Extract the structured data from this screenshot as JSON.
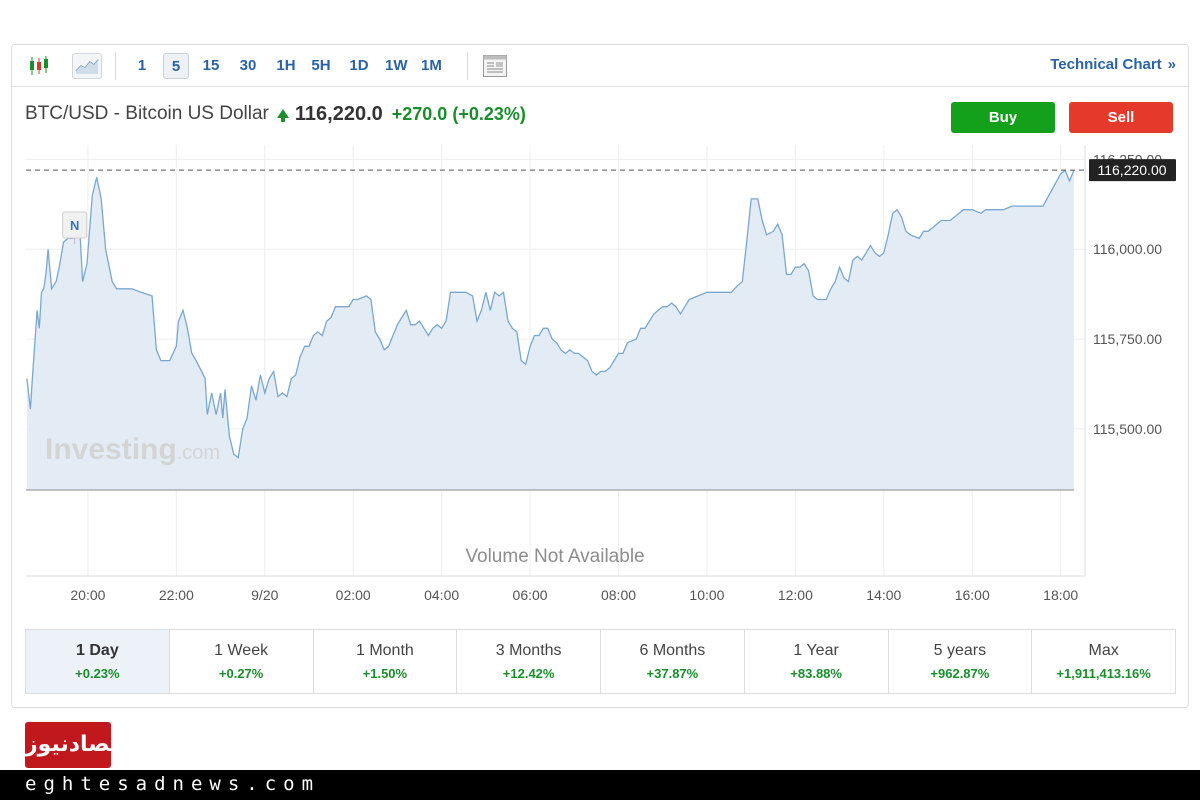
{
  "toolbar": {
    "candles_icon": "candlestick-chart-icon",
    "line_icon": "line-chart-icon",
    "intervals": [
      "1",
      "5",
      "15",
      "30",
      "1H",
      "5H",
      "1D",
      "1W",
      "1M"
    ],
    "active_interval": "5",
    "layout_icon": "chart-layout-icon",
    "technical_link": "Technical Chart",
    "technical_chevron": "»"
  },
  "header": {
    "pair": "BTC/USD - Bitcoin US Dollar",
    "price": "116,220.0",
    "change": "+270.0",
    "change_pct": "(+0.23%)",
    "buy_label": "Buy",
    "sell_label": "Sell"
  },
  "chart_data": {
    "type": "area",
    "y_ticks": [
      "116,250.00",
      "116,000.00",
      "115,750.00",
      "115,500.00"
    ],
    "y_tick_values": [
      116250,
      116000,
      115750,
      115500
    ],
    "ylim": [
      115330,
      116290
    ],
    "current_value_label": "116,220.00",
    "current_value": 116220,
    "x_ticks": [
      "20:00",
      "22:00",
      "9/20",
      "02:00",
      "04:00",
      "06:00",
      "08:00",
      "10:00",
      "12:00",
      "14:00",
      "16:00",
      "18:00"
    ],
    "x_range_hours": [
      18.6,
      42.55
    ],
    "news_marker": "N",
    "news_marker_time": 19.7,
    "watermark": "Investing",
    "watermark_suffix": ".com",
    "volume_message": "Volume Not Available",
    "series": [
      {
        "values": [
          [
            18.62,
            115640
          ],
          [
            18.7,
            115555
          ],
          [
            18.75,
            115650
          ],
          [
            18.85,
            115830
          ],
          [
            18.9,
            115780
          ],
          [
            18.95,
            115880
          ],
          [
            19.0,
            115890
          ],
          [
            19.05,
            115930
          ],
          [
            19.1,
            116000
          ],
          [
            19.18,
            115890
          ],
          [
            19.28,
            115910
          ],
          [
            19.35,
            115950
          ],
          [
            19.45,
            116020
          ],
          [
            19.55,
            116030
          ],
          [
            19.65,
            116030
          ],
          [
            19.75,
            116040
          ],
          [
            19.82,
            116050
          ],
          [
            19.88,
            115910
          ],
          [
            19.98,
            115960
          ],
          [
            20.1,
            116150
          ],
          [
            20.2,
            116200
          ],
          [
            20.3,
            116140
          ],
          [
            20.4,
            116000
          ],
          [
            20.55,
            115910
          ],
          [
            20.65,
            115890
          ],
          [
            20.8,
            115890
          ],
          [
            21.0,
            115890
          ],
          [
            21.2,
            115880
          ],
          [
            21.45,
            115870
          ],
          [
            21.55,
            115720
          ],
          [
            21.65,
            115690
          ],
          [
            21.85,
            115690
          ],
          [
            22.0,
            115730
          ],
          [
            22.05,
            115800
          ],
          [
            22.15,
            115830
          ],
          [
            22.25,
            115780
          ],
          [
            22.35,
            115710
          ],
          [
            22.45,
            115690
          ],
          [
            22.65,
            115640
          ],
          [
            22.7,
            115540
          ],
          [
            22.8,
            115600
          ],
          [
            22.9,
            115540
          ],
          [
            23.0,
            115600
          ],
          [
            23.05,
            115530
          ],
          [
            23.1,
            115610
          ],
          [
            23.2,
            115480
          ],
          [
            23.3,
            115430
          ],
          [
            23.4,
            115420
          ],
          [
            23.5,
            115500
          ],
          [
            23.6,
            115530
          ],
          [
            23.7,
            115620
          ],
          [
            23.8,
            115580
          ],
          [
            23.9,
            115650
          ],
          [
            24.0,
            115600
          ],
          [
            24.1,
            115640
          ],
          [
            24.2,
            115660
          ],
          [
            24.3,
            115590
          ],
          [
            24.4,
            115600
          ],
          [
            24.5,
            115590
          ],
          [
            24.6,
            115640
          ],
          [
            24.7,
            115650
          ],
          [
            24.8,
            115700
          ],
          [
            24.9,
            115730
          ],
          [
            25.0,
            115730
          ],
          [
            25.1,
            115760
          ],
          [
            25.2,
            115770
          ],
          [
            25.3,
            115760
          ],
          [
            25.4,
            115800
          ],
          [
            25.5,
            115810
          ],
          [
            25.6,
            115840
          ],
          [
            25.75,
            115840
          ],
          [
            25.9,
            115840
          ],
          [
            26.0,
            115860
          ],
          [
            26.1,
            115860
          ],
          [
            26.3,
            115870
          ],
          [
            26.4,
            115860
          ],
          [
            26.5,
            115770
          ],
          [
            26.6,
            115750
          ],
          [
            26.7,
            115720
          ],
          [
            26.8,
            115730
          ],
          [
            26.9,
            115760
          ],
          [
            27.0,
            115790
          ],
          [
            27.1,
            115810
          ],
          [
            27.2,
            115830
          ],
          [
            27.3,
            115790
          ],
          [
            27.4,
            115790
          ],
          [
            27.5,
            115800
          ],
          [
            27.6,
            115780
          ],
          [
            27.7,
            115760
          ],
          [
            27.8,
            115780
          ],
          [
            27.9,
            115790
          ],
          [
            28.0,
            115780
          ],
          [
            28.1,
            115800
          ],
          [
            28.2,
            115880
          ],
          [
            28.4,
            115880
          ],
          [
            28.55,
            115880
          ],
          [
            28.7,
            115870
          ],
          [
            28.8,
            115800
          ],
          [
            28.9,
            115830
          ],
          [
            29.0,
            115880
          ],
          [
            29.1,
            115830
          ],
          [
            29.2,
            115880
          ],
          [
            29.3,
            115870
          ],
          [
            29.4,
            115880
          ],
          [
            29.5,
            115800
          ],
          [
            29.6,
            115780
          ],
          [
            29.7,
            115770
          ],
          [
            29.8,
            115690
          ],
          [
            29.9,
            115680
          ],
          [
            30.0,
            115730
          ],
          [
            30.1,
            115760
          ],
          [
            30.2,
            115760
          ],
          [
            30.3,
            115780
          ],
          [
            30.4,
            115780
          ],
          [
            30.5,
            115750
          ],
          [
            30.6,
            115740
          ],
          [
            30.7,
            115720
          ],
          [
            30.8,
            115710
          ],
          [
            30.9,
            115720
          ],
          [
            31.0,
            115710
          ],
          [
            31.1,
            115710
          ],
          [
            31.2,
            115700
          ],
          [
            31.3,
            115690
          ],
          [
            31.4,
            115660
          ],
          [
            31.5,
            115650
          ],
          [
            31.6,
            115660
          ],
          [
            31.7,
            115660
          ],
          [
            31.8,
            115670
          ],
          [
            31.9,
            115690
          ],
          [
            32.0,
            115710
          ],
          [
            32.1,
            115710
          ],
          [
            32.2,
            115740
          ],
          [
            32.4,
            115750
          ],
          [
            32.5,
            115780
          ],
          [
            32.6,
            115780
          ],
          [
            32.7,
            115800
          ],
          [
            32.8,
            115820
          ],
          [
            32.9,
            115830
          ],
          [
            33.0,
            115840
          ],
          [
            33.1,
            115840
          ],
          [
            33.2,
            115850
          ],
          [
            33.3,
            115840
          ],
          [
            33.4,
            115820
          ],
          [
            33.5,
            115840
          ],
          [
            33.6,
            115860
          ],
          [
            33.8,
            115870
          ],
          [
            34.0,
            115880
          ],
          [
            34.3,
            115880
          ],
          [
            34.55,
            115880
          ],
          [
            34.7,
            115900
          ],
          [
            34.8,
            115910
          ],
          [
            34.9,
            116020
          ],
          [
            35.0,
            116140
          ],
          [
            35.15,
            116140
          ],
          [
            35.25,
            116080
          ],
          [
            35.35,
            116040
          ],
          [
            35.5,
            116050
          ],
          [
            35.6,
            116070
          ],
          [
            35.7,
            116040
          ],
          [
            35.8,
            115930
          ],
          [
            35.9,
            115930
          ],
          [
            36.0,
            115950
          ],
          [
            36.1,
            115950
          ],
          [
            36.2,
            115960
          ],
          [
            36.3,
            115940
          ],
          [
            36.4,
            115870
          ],
          [
            36.5,
            115860
          ],
          [
            36.6,
            115860
          ],
          [
            36.7,
            115860
          ],
          [
            36.8,
            115890
          ],
          [
            36.9,
            115910
          ],
          [
            37.0,
            115950
          ],
          [
            37.1,
            115920
          ],
          [
            37.2,
            115910
          ],
          [
            37.3,
            115970
          ],
          [
            37.4,
            115980
          ],
          [
            37.5,
            115970
          ],
          [
            37.6,
            115990
          ],
          [
            37.7,
            116010
          ],
          [
            37.8,
            115990
          ],
          [
            37.9,
            115980
          ],
          [
            38.0,
            115990
          ],
          [
            38.1,
            116040
          ],
          [
            38.2,
            116100
          ],
          [
            38.3,
            116110
          ],
          [
            38.4,
            116090
          ],
          [
            38.5,
            116050
          ],
          [
            38.6,
            116040
          ],
          [
            38.8,
            116030
          ],
          [
            38.9,
            116050
          ],
          [
            39.0,
            116050
          ],
          [
            39.1,
            116060
          ],
          [
            39.3,
            116080
          ],
          [
            39.5,
            116080
          ],
          [
            39.6,
            116090
          ],
          [
            39.8,
            116110
          ],
          [
            40.0,
            116110
          ],
          [
            40.2,
            116100
          ],
          [
            40.3,
            116110
          ],
          [
            40.5,
            116110
          ],
          [
            40.7,
            116110
          ],
          [
            40.9,
            116120
          ],
          [
            41.1,
            116120
          ],
          [
            41.3,
            116120
          ],
          [
            41.5,
            116120
          ],
          [
            41.6,
            116120
          ],
          [
            42.0,
            116210
          ],
          [
            42.1,
            116220
          ],
          [
            42.2,
            116190
          ],
          [
            42.3,
            116220
          ]
        ]
      }
    ]
  },
  "periods": [
    {
      "label": "1 Day",
      "change": "+0.23%"
    },
    {
      "label": "1 Week",
      "change": "+0.27%"
    },
    {
      "label": "1 Month",
      "change": "+1.50%"
    },
    {
      "label": "3 Months",
      "change": "+12.42%"
    },
    {
      "label": "6 Months",
      "change": "+37.87%"
    },
    {
      "label": "1 Year",
      "change": "+83.88%"
    },
    {
      "label": "5 years",
      "change": "+962.87%"
    },
    {
      "label": "Max",
      "change": "+1,911,413.16%"
    }
  ],
  "footer": {
    "logo_text": "اقتصادنیوز",
    "site": "eghtesadnews.com"
  }
}
